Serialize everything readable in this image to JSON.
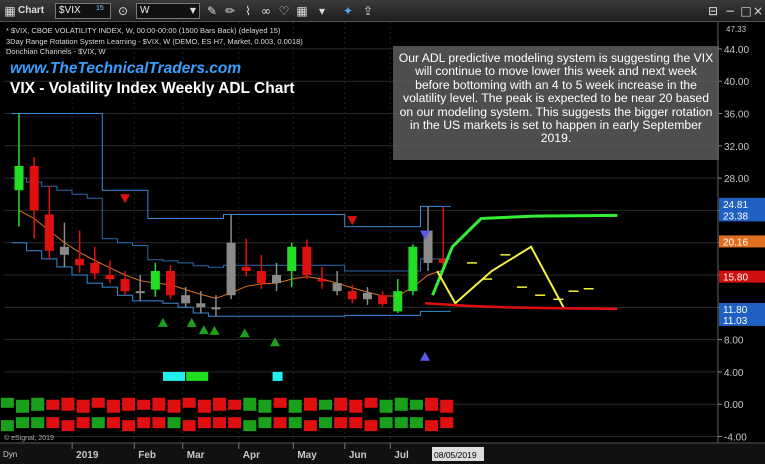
{
  "toolbar": {
    "app_label": "Chart",
    "symbol": "$VIX",
    "symbol_count": "15",
    "interval": "W",
    "search_icon": "magnifier-icon",
    "tool_icons": [
      "wrench-icon",
      "pencil-icon",
      "brush-icon",
      "link-icon",
      "heart-icon",
      "grid-icon",
      "twitter-icon",
      "share-icon"
    ]
  },
  "header": {
    "line1": "* $VIX, CBOE VOLATILITY INDEX, W, 00:00-00:00 (1500 Bars Back) (delayed 15)",
    "line2": "3Day Range Rotation System Learning - $VIX, W (DEMO, ES H7, Market, 0.003, 0.0018)",
    "line3": "Donchian Channels - $VIX, W"
  },
  "site": "www.TheTechnicalTraders.com",
  "chart_title": "VIX - Volatility Index Weekly ADL Chart",
  "callout": "Our ADL predictive modeling system is suggesting the VIX will continue to move lower this week and next week before bottoming with an 4 to 5 week increase in the volatility level.  The peak is expected to be near 20 based on our modeling system.  This suggests the bigger rotation in the US markets is set to happen in early September 2019.",
  "footer": {
    "credit": "© eSignal, 2019",
    "dyn": "Dyn",
    "date_tag": "08/05/2019"
  },
  "chart_data": {
    "type": "candlestick",
    "title": "VIX - Volatility Index Weekly ADL Chart",
    "x_ticks": [
      "2019",
      "Feb",
      "Mar",
      "Apr",
      "May",
      "Jun",
      "Jul",
      "08/05/2019"
    ],
    "y_ticks": [
      44.0,
      40.0,
      36.0,
      32.0,
      28.0,
      24.0,
      20.0,
      16.0,
      12.0,
      8.0,
      4.0,
      0.0,
      -4.0
    ],
    "ylim": [
      -4.8,
      47.33
    ],
    "y_top_label": "47.33",
    "price_tags": [
      {
        "value": 24.81,
        "label": "24.81",
        "color": "#2060c0"
      },
      {
        "value": 23.38,
        "label": "23.38",
        "color": "#2060c0"
      },
      {
        "value": 20.16,
        "label": "20.16",
        "color": "#e07020"
      },
      {
        "value": 15.8,
        "label": "15.80",
        "color": "#d01010"
      },
      {
        "value": 11.8,
        "label": "11.80",
        "color": "#2060c0"
      },
      {
        "value": 11.03,
        "label": "11.03",
        "color": "#2060c0"
      }
    ],
    "candles": [
      {
        "o": 26.5,
        "h": 36.0,
        "l": 22.0,
        "c": 29.5,
        "color": "green"
      },
      {
        "o": 29.5,
        "h": 30.6,
        "l": 20.5,
        "c": 24.0,
        "color": "red"
      },
      {
        "o": 23.5,
        "h": 27.0,
        "l": 18.0,
        "c": 19.0,
        "color": "red"
      },
      {
        "o": 19.5,
        "h": 22.5,
        "l": 17.0,
        "c": 18.5,
        "color": "gray"
      },
      {
        "o": 18.0,
        "h": 21.5,
        "l": 16.3,
        "c": 17.2,
        "color": "red"
      },
      {
        "o": 17.5,
        "h": 19.5,
        "l": 15.5,
        "c": 16.2,
        "color": "red"
      },
      {
        "o": 16.0,
        "h": 17.8,
        "l": 15.0,
        "c": 15.5,
        "color": "red"
      },
      {
        "o": 15.5,
        "h": 16.5,
        "l": 13.5,
        "c": 14.0,
        "color": "red"
      },
      {
        "o": 14.0,
        "h": 16.0,
        "l": 12.8,
        "c": 13.8,
        "color": "gray"
      },
      {
        "o": 14.2,
        "h": 17.5,
        "l": 13.3,
        "c": 16.5,
        "color": "green"
      },
      {
        "o": 16.5,
        "h": 17.2,
        "l": 13.0,
        "c": 13.5,
        "color": "red"
      },
      {
        "o": 13.5,
        "h": 14.5,
        "l": 12.0,
        "c": 12.5,
        "color": "gray"
      },
      {
        "o": 12.5,
        "h": 14.0,
        "l": 11.3,
        "c": 12.0,
        "color": "gray"
      },
      {
        "o": 12.0,
        "h": 13.5,
        "l": 10.9,
        "c": 12.0,
        "color": "gray"
      },
      {
        "o": 13.5,
        "h": 23.5,
        "l": 13.0,
        "c": 20.0,
        "color": "gray"
      },
      {
        "o": 17.0,
        "h": 20.5,
        "l": 15.8,
        "c": 16.5,
        "color": "red"
      },
      {
        "o": 16.5,
        "h": 18.5,
        "l": 14.3,
        "c": 15.0,
        "color": "red"
      },
      {
        "o": 15.0,
        "h": 17.5,
        "l": 14.0,
        "c": 16.0,
        "color": "gray"
      },
      {
        "o": 16.5,
        "h": 20.0,
        "l": 14.5,
        "c": 19.5,
        "color": "green"
      },
      {
        "o": 19.5,
        "h": 20.4,
        "l": 15.5,
        "c": 16.0,
        "color": "red"
      },
      {
        "o": 15.5,
        "h": 17.0,
        "l": 14.3,
        "c": 15.2,
        "color": "red"
      },
      {
        "o": 15.0,
        "h": 16.5,
        "l": 13.5,
        "c": 14.0,
        "color": "gray"
      },
      {
        "o": 14.0,
        "h": 14.8,
        "l": 12.5,
        "c": 13.0,
        "color": "red"
      },
      {
        "o": 13.0,
        "h": 14.5,
        "l": 12.3,
        "c": 13.8,
        "color": "gray"
      },
      {
        "o": 13.5,
        "h": 14.0,
        "l": 12.1,
        "c": 12.4,
        "color": "red"
      },
      {
        "o": 11.5,
        "h": 15.5,
        "l": 11.3,
        "c": 14.0,
        "color": "green"
      },
      {
        "o": 14.0,
        "h": 19.8,
        "l": 13.5,
        "c": 19.5,
        "color": "green"
      },
      {
        "o": 17.5,
        "h": 24.5,
        "l": 16.5,
        "c": 21.5,
        "color": "gray"
      },
      {
        "o": 18.0,
        "h": 24.5,
        "l": 17.0,
        "c": 17.5,
        "color": "red"
      }
    ],
    "donchian_upper": [
      36.0,
      36.0,
      36.0,
      36.0,
      36.0,
      36.0,
      26.5,
      26.5,
      26.5,
      23.0,
      23.0,
      23.0,
      23.0,
      23.0,
      23.5,
      23.5,
      23.5,
      23.5,
      23.5,
      23.5,
      23.5,
      23.5,
      22.0,
      22.0,
      22.0,
      22.0,
      22.0,
      24.5,
      24.5
    ],
    "donchian_lower": [
      20.0,
      19.0,
      18.0,
      17.0,
      16.0,
      15.0,
      14.5,
      13.5,
      12.8,
      12.8,
      12.5,
      12.0,
      11.3,
      10.9,
      10.9,
      10.9,
      10.9,
      10.9,
      10.9,
      10.9,
      10.9,
      10.9,
      11.0,
      11.0,
      11.0,
      11.0,
      11.0,
      11.5,
      11.5
    ],
    "moving_average": [
      24.0,
      23.0,
      21.5,
      20.0,
      18.8,
      17.8,
      16.9,
      16.0,
      15.3,
      15.0,
      14.8,
      14.2,
      13.6,
      13.1,
      13.8,
      14.6,
      14.9,
      15.0,
      15.5,
      15.8,
      15.5,
      15.0,
      14.4,
      13.9,
      13.4,
      13.4,
      14.5,
      16.0,
      16.6
    ],
    "adl_forecast_green": [
      13.5,
      19.5,
      23.0,
      23.3,
      23.38
    ],
    "adl_forecast_yellow": [
      16.5,
      12.5,
      16.5,
      19.5,
      11.8
    ],
    "adl_forecast_red": [
      12.5,
      12.2,
      12.0,
      11.9,
      11.8
    ],
    "markers": [
      {
        "type": "sell",
        "color": "red"
      },
      {
        "type": "sell",
        "color": "red"
      },
      {
        "type": "buy",
        "color": "green"
      },
      {
        "type": "buy",
        "color": "green"
      },
      {
        "type": "forecast",
        "color": "blue"
      }
    ]
  }
}
